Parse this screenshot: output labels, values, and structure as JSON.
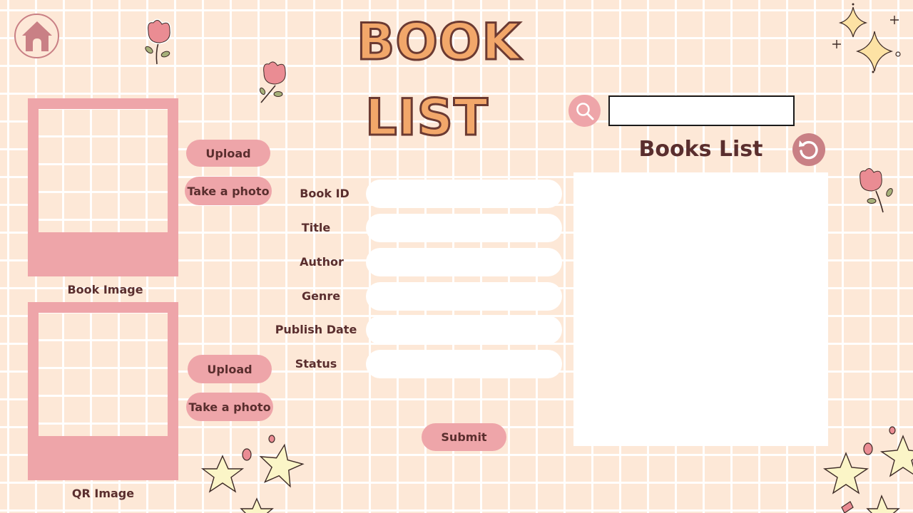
{
  "header": {
    "title_line1": "BOOK",
    "title_line2": "LIST",
    "home_icon": "home-icon"
  },
  "images": {
    "book": {
      "caption": "Book Image",
      "upload_label": "Upload",
      "photo_label": "Take a photo"
    },
    "qr": {
      "caption": "QR Image",
      "upload_label": "Upload",
      "photo_label": "Take a photo"
    }
  },
  "form": {
    "fields": [
      {
        "label": "Book ID",
        "value": ""
      },
      {
        "label": "Title",
        "value": ""
      },
      {
        "label": "Author",
        "value": ""
      },
      {
        "label": "Genre",
        "value": ""
      },
      {
        "label": "Publish Date",
        "value": ""
      },
      {
        "label": "Status",
        "value": ""
      }
    ],
    "submit_label": "Submit"
  },
  "books_list": {
    "search_icon": "search-icon",
    "search_value": "",
    "heading": "Books List",
    "refresh_icon": "refresh-icon",
    "items": []
  },
  "colors": {
    "background": "#fde8d7",
    "accent_pink": "#eea5a9",
    "deep_pink": "#c98085",
    "text_brown": "#5a2e2e",
    "title_orange": "#f2a76a"
  }
}
